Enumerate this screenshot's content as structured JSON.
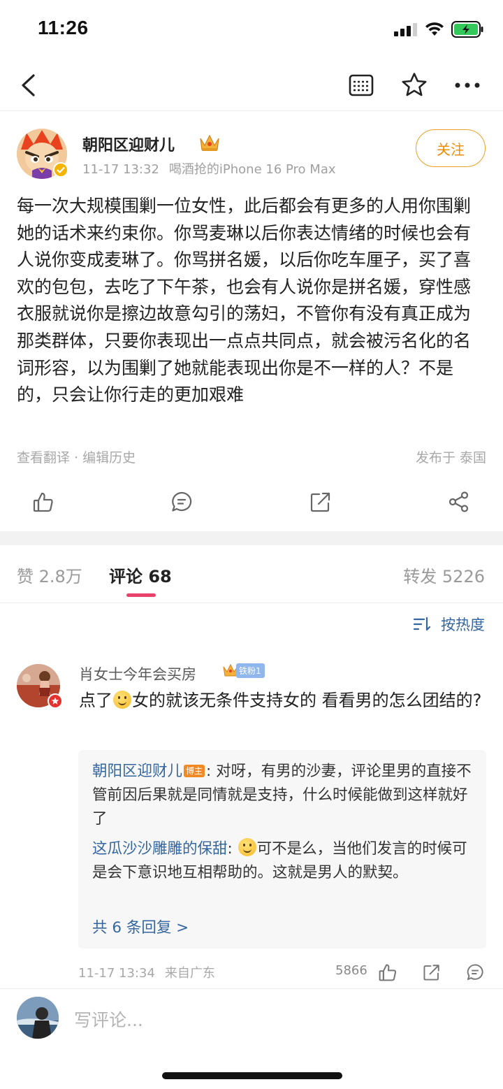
{
  "status_bar": {
    "time": "11:26",
    "icons": [
      "signal-icon",
      "wifi-icon",
      "battery-icon"
    ]
  },
  "nav": {
    "icons": [
      "back-icon",
      "comment-list-icon",
      "star-icon",
      "more-icon"
    ]
  },
  "post": {
    "author": "朝阳区迎财儿",
    "date": "11-17 13:32",
    "source": "喝酒抢的iPhone 16 Pro Max",
    "follow_label": "关注",
    "text": "每一次大规模围剿一位女性，此后都会有更多的人用你围剿她的话术来约束你。你骂麦琳以后你表达情绪的时候也会有人说你变成麦琳了。你骂拼名媛，以后你吃车厘子，买了喜欢的包包，去吃了下午茶，也会有人说你是拼名媛，穿性感衣服就说你是擦边故意勾引的荡妇，不管你有没有真正成为那类群体，只要你表现出一点点共同点，就会被污名化的名词形容，以为围剿了她就能表现出你是不一样的人？不是的，只会让你行走的更加艰难",
    "footer_left": "查看翻译 · 编辑历史",
    "footer_right": "发布于 泰国",
    "actions": [
      "like-icon",
      "comment-icon",
      "repost-icon",
      "share-icon"
    ]
  },
  "tabs": {
    "likes": "赞 2.8万",
    "comments": "评论 68",
    "reposts": "转发 5226"
  },
  "sort": {
    "label": "按热度"
  },
  "comment": {
    "user": "肖女士今年会买房",
    "fan_badge": "铁粉1",
    "text_before_emoji": "点了",
    "text_after_emoji": "女的就该无条件支持女的 看看男的怎么团结的?",
    "replies": [
      {
        "user": "朝阳区迎财儿",
        "tag": "博主",
        "text": ": 对呀，有男的沙妻，评论里男的直接不管前因后果就是同情就是支持，什么时候能做到这样就好了"
      },
      {
        "user": "这瓜沙沙雕雕的保甜",
        "text": "可不是么，当他们发言的时候可是会下意识地互相帮助的。这就是男人的默契。"
      }
    ],
    "more_replies": "共 6 条回复 >",
    "date": "11-17 13:34",
    "location": "来自广东",
    "like_count": "5866"
  },
  "composer": {
    "placeholder": "写评论..."
  },
  "colors": {
    "accent_orange": "#ef8c00",
    "link_blue": "#36669f",
    "tab_underline": "#e8426a",
    "battery_green": "#34c759"
  }
}
